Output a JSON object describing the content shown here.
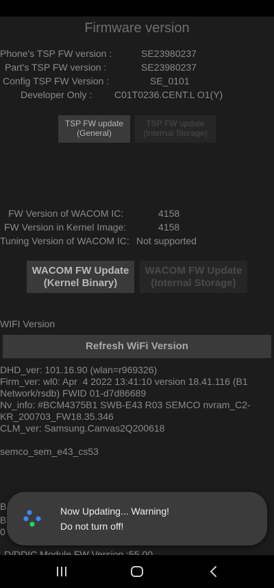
{
  "title": "Firmware version",
  "tsp": {
    "phone_label": "Phone's TSP FW version :",
    "phone_value": "SE23980237",
    "part_label": "Part's TSP FW version :",
    "part_value": "SE23980237",
    "config_label": "Config TSP FW Version :",
    "config_value": "SE_0101",
    "dev_label": "Developer Only :",
    "dev_value": "C01T0236.CENT.L O1(Y)",
    "btn_general": "TSP FW update\n(General)",
    "btn_internal": "TSP FW update\n(Internal Storage)"
  },
  "wacom": {
    "ic_label": "FW Version of WACOM IC:",
    "ic_value": "4158",
    "kernel_label": "FW Version in Kernel Image:",
    "kernel_value": "4158",
    "tuning_label": "Tuning Version of WACOM IC:",
    "tuning_value": "Not supported",
    "btn_kernel": "WACOM FW Update\n(Kernel Binary)",
    "btn_internal": "WACOM FW Update\n(Internal Storage)"
  },
  "wifi": {
    "section_label": "WIFI Version",
    "refresh_button": "Refresh WiFi Version",
    "info": "DHD_ver: 101.16.90 (wlan=r969326)\nFirm_ver: wl0: Apr  4 2022 13:41:10 version 18.41.116 (B1 Network/rsdb) FWID 01-d7d86689\nNv_info: #BCM4375B1 SWB-E43 R03 SEMCO nvram_C2-KR_200703_FW18.35.346\nCLM_ver: Samsung.Canvas2Q200618\n\nsemco_sem_e43_cs53"
  },
  "partial": {
    "b1": "B",
    "b2": "B",
    "zero": "0",
    "ddi": "D/DDIC Module FW Version :55 00"
  },
  "toast": {
    "line1": "Now Updating... Warning!",
    "line2": "Do not turn off!",
    "icon_colors": [
      "#4285f4",
      "#4285f4",
      "#4285f4",
      "#1ed760"
    ]
  },
  "navbar": {
    "recents_icon": "recents-icon",
    "home_icon": "home-icon",
    "back_icon": "back-icon"
  }
}
